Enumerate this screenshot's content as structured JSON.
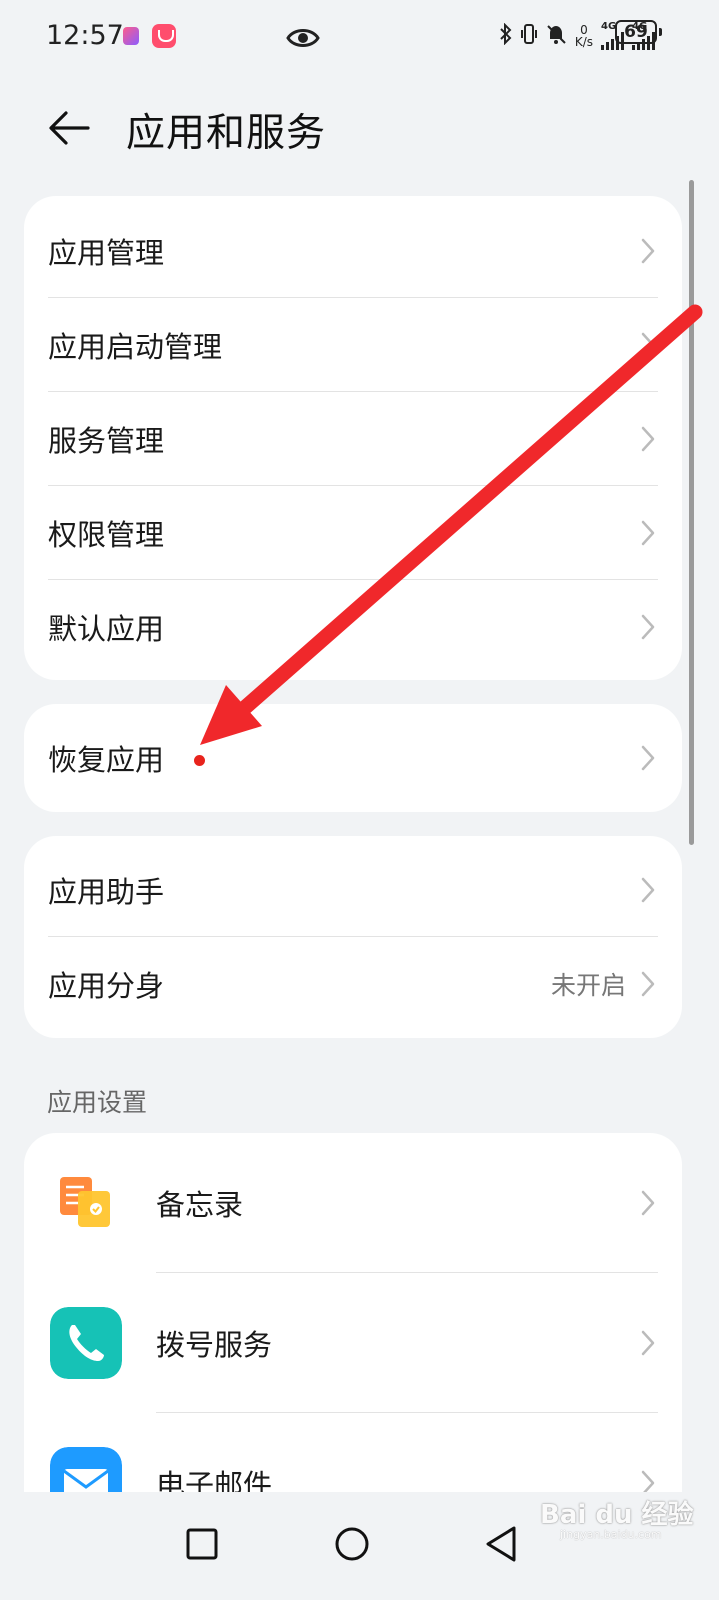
{
  "status_bar": {
    "time": "12:57",
    "speed_value": "0",
    "speed_unit": "K/s",
    "network_1": "4G",
    "network_2": "4G",
    "battery": "69"
  },
  "header": {
    "title": "应用和服务"
  },
  "group1": {
    "items": [
      {
        "label": "应用管理"
      },
      {
        "label": "应用启动管理"
      },
      {
        "label": "服务管理"
      },
      {
        "label": "权限管理"
      },
      {
        "label": "默认应用"
      }
    ]
  },
  "group2": {
    "items": [
      {
        "label": "恢复应用"
      }
    ]
  },
  "group3": {
    "items": [
      {
        "label": "应用助手"
      },
      {
        "label": "应用分身",
        "value": "未开启"
      }
    ]
  },
  "app_settings": {
    "section_title": "应用设置",
    "items": [
      {
        "label": "备忘录",
        "icon": "memo-icon"
      },
      {
        "label": "拨号服务",
        "icon": "phone-icon"
      },
      {
        "label": "电子邮件",
        "icon": "mail-icon"
      }
    ]
  },
  "watermark": {
    "text": "Bai du 经验",
    "sub": "jingyan.baidu.com"
  },
  "colors": {
    "background": "#f1f3f5",
    "card": "#ffffff",
    "annotation_red": "#e8231c",
    "phone_icon": "#16c2b6",
    "memo_icon": "#ff8a3d",
    "mail_icon": "#1e9bff"
  }
}
